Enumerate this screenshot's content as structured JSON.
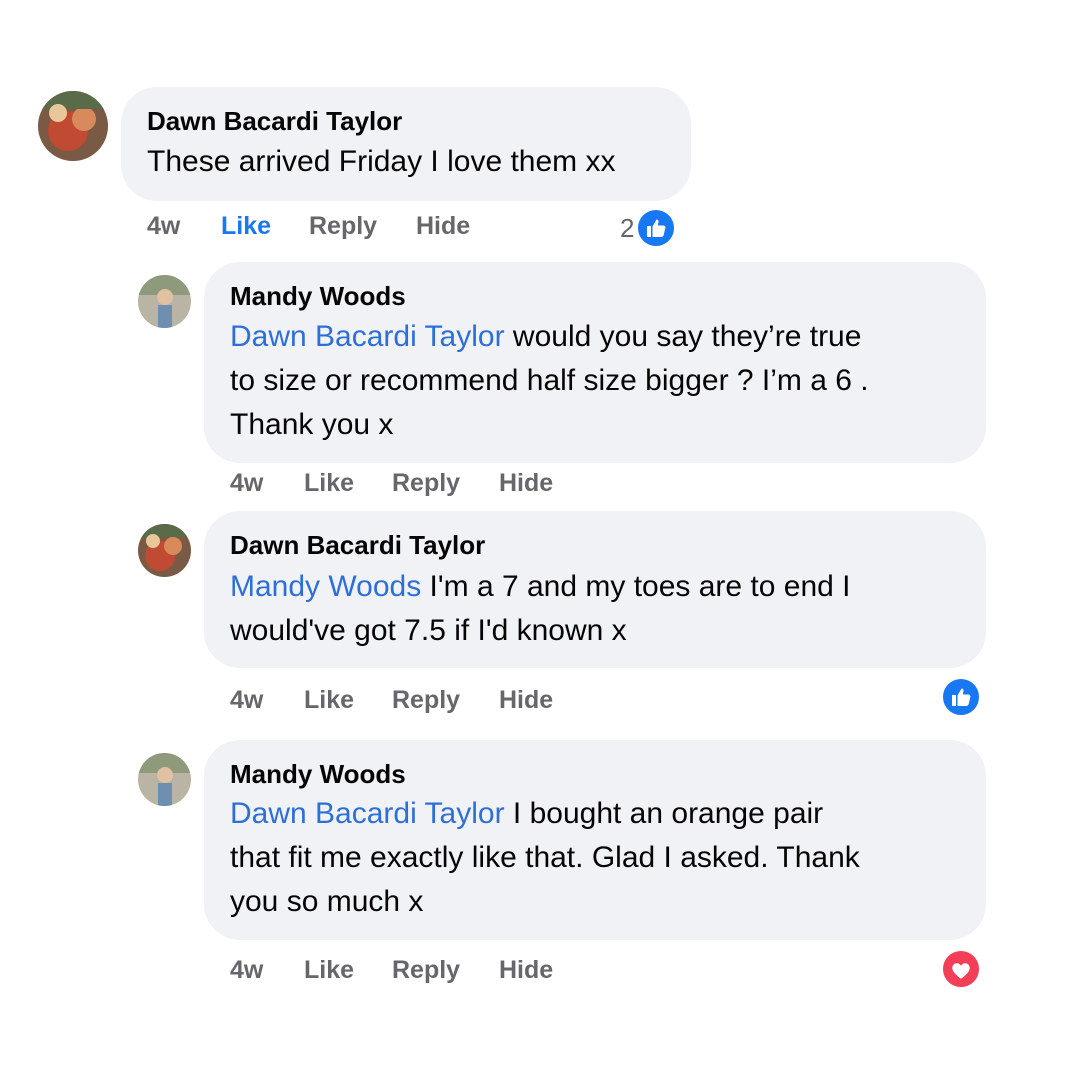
{
  "comments": [
    {
      "author": "Dawn Bacardi Taylor",
      "mention": "",
      "text": "These arrived Friday I love them xx",
      "time": "4w",
      "like": "Like",
      "reply": "Reply",
      "hide": "Hide",
      "reaction_count": "2",
      "reaction": "like",
      "liked_by_viewer": true
    },
    {
      "author": "Mandy Woods",
      "mention": "Dawn Bacardi Taylor",
      "text_line1": " would you say they’re true",
      "text_line2": "to size or recommend half size bigger ? I’m a 6 .",
      "text_line3": "Thank you x",
      "time": "4w",
      "like": "Like",
      "reply": "Reply",
      "hide": "Hide"
    },
    {
      "author": "Dawn Bacardi Taylor",
      "mention": "Mandy Woods",
      "text_line1": " I'm a 7 and my toes are to end I",
      "text_line2": "would've got 7.5 if I'd known x",
      "time": "4w",
      "like": "Like",
      "reply": "Reply",
      "hide": "Hide",
      "reaction": "like"
    },
    {
      "author": "Mandy Woods",
      "mention": "Dawn Bacardi Taylor",
      "text_line1": " I bought an orange pair",
      "text_line2": "that fit me exactly like that. Glad I asked. Thank",
      "text_line3": "you so much x",
      "time": "4w",
      "like": "Like",
      "reply": "Reply",
      "hide": "Hide",
      "reaction": "love"
    }
  ],
  "colors": {
    "bubble": "#f0f2f5",
    "mention": "#2e6fd6",
    "like_blue": "#1877f2",
    "love_red": "#f33e58",
    "meta_gray": "#65676b"
  }
}
